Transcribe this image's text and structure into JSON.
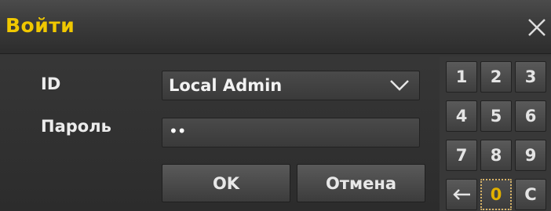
{
  "dialog": {
    "title": "Войти",
    "close_icon": "close-icon",
    "colors": {
      "title": "#f0c800",
      "background": "#2f2f2f",
      "selected_key_border": "#d8b468"
    }
  },
  "form": {
    "id_label": "ID",
    "id_value": "Local Admin",
    "id_dropdown_icon": "chevron-down-icon",
    "password_label": "Пароль",
    "password_value": "••"
  },
  "buttons": {
    "ok": "OK",
    "cancel": "Отмена"
  },
  "keypad": {
    "keys": [
      "1",
      "2",
      "3",
      "4",
      "5",
      "6",
      "7",
      "8",
      "9",
      "0",
      "C"
    ],
    "backspace_icon": "backspace-arrow-icon",
    "selected_key": "0"
  }
}
